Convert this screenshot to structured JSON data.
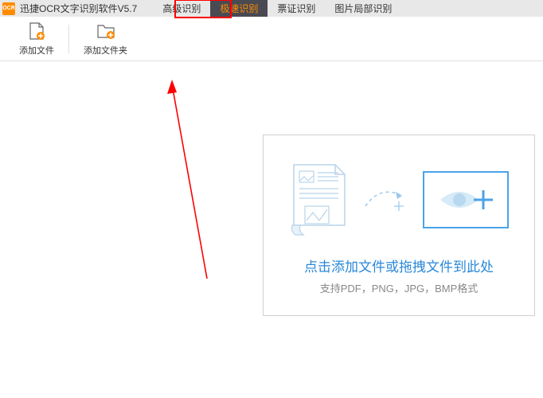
{
  "app": {
    "logo_text": "OCR",
    "title": "迅捷OCR文字识别软件V5.7"
  },
  "menu": {
    "tabs": [
      {
        "label": "高级识别",
        "active": false
      },
      {
        "label": "极速识别",
        "active": true
      },
      {
        "label": "票证识别",
        "active": false
      },
      {
        "label": "图片局部识别",
        "active": false
      }
    ]
  },
  "toolbar": {
    "add_file_label": "添加文件",
    "add_folder_label": "添加文件夹"
  },
  "dropzone": {
    "title": "点击添加文件或拖拽文件到此处",
    "subtitle": "支持PDF，PNG，JPG，BMP格式"
  },
  "icons": {
    "add_file": "add-file-icon",
    "add_folder": "add-folder-icon",
    "document": "document-icon",
    "eye_preview": "eye-preview-icon",
    "dashed_arrow": "dashed-arrow-icon",
    "sparkle": "sparkle-icon"
  },
  "colors": {
    "accent": "#ff8c00",
    "link": "#2a88d8",
    "icon_blue": "#4aa3e8",
    "annotation": "#ff0000"
  }
}
